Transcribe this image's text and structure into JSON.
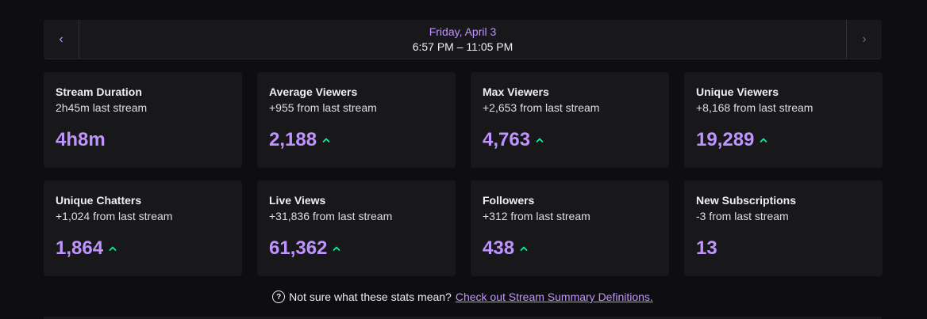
{
  "date_nav": {
    "prev_icon": "chevron-left-icon",
    "next_icon": "chevron-right-icon",
    "prev_glyph": "‹",
    "next_glyph": "›",
    "day": "Friday, April 3",
    "range": "6:57 PM – 11:05 PM"
  },
  "cards": [
    {
      "title": "Stream Duration",
      "sub": "2h45m last stream",
      "value": "4h8m",
      "trend": "none"
    },
    {
      "title": "Average Viewers",
      "sub": "+955 from last stream",
      "value": "2,188",
      "trend": "up"
    },
    {
      "title": "Max Viewers",
      "sub": "+2,653 from last stream",
      "value": "4,763",
      "trend": "up"
    },
    {
      "title": "Unique Viewers",
      "sub": "+8,168 from last stream",
      "value": "19,289",
      "trend": "up"
    },
    {
      "title": "Unique Chatters",
      "sub": "+1,024 from last stream",
      "value": "1,864",
      "trend": "up"
    },
    {
      "title": "Live Views",
      "sub": "+31,836 from last stream",
      "value": "61,362",
      "trend": "up"
    },
    {
      "title": "Followers",
      "sub": "+312 from last stream",
      "value": "438",
      "trend": "up"
    },
    {
      "title": "New Subscriptions",
      "sub": "-3 from last stream",
      "value": "13",
      "trend": "none"
    }
  ],
  "footer": {
    "help_glyph": "?",
    "text": "Not sure what these stats mean?",
    "link": "Check out Stream Summary Definitions."
  },
  "colors": {
    "accent": "#bf94ff",
    "trend_up": "#00f593",
    "background": "#0e0e10",
    "card": "#18181b"
  }
}
